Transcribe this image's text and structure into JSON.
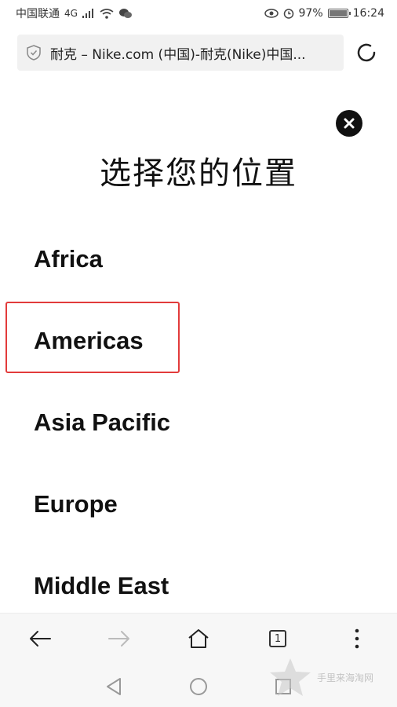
{
  "status_bar": {
    "carrier": "中国联通",
    "network": "4G",
    "battery": "97%",
    "time": "16:24"
  },
  "browser": {
    "url_title": "耐克 – Nike.com (中国)-耐克(Nike)中国...",
    "tab_count": "1"
  },
  "dialog": {
    "title": "选择您的位置",
    "regions": [
      "Africa",
      "Americas",
      "Asia Pacific",
      "Europe",
      "Middle East"
    ],
    "highlighted_region": "Americas"
  },
  "colors": {
    "highlight": "#e23b3b",
    "text": "#111111",
    "nav_bg": "#f7f7f7"
  },
  "watermark": {
    "text": "手里来海淘网"
  }
}
